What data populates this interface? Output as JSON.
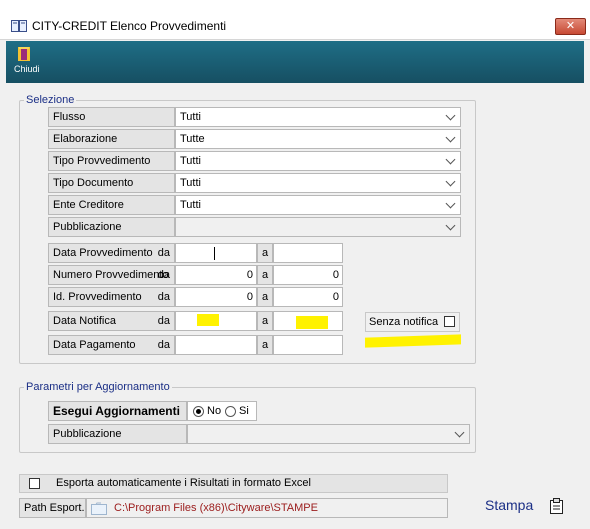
{
  "window": {
    "title": "CITY-CREDIT Elenco Provvedimenti",
    "close_label": "✕"
  },
  "toolbar": {
    "close_label": "Chiudi"
  },
  "selezione": {
    "legend": "Selezione",
    "dropdowns": [
      {
        "label": "Flusso",
        "value": "Tutti"
      },
      {
        "label": "Elaborazione",
        "value": "Tutte"
      },
      {
        "label": "Tipo Provvedimento",
        "value": "Tutti"
      },
      {
        "label": "Tipo Documento",
        "value": "Tutti"
      },
      {
        "label": "Ente Creditore",
        "value": "Tutti"
      },
      {
        "label": "Pubblicazione",
        "value": ""
      }
    ],
    "ranges": [
      {
        "label": "Data Provvedimento",
        "da": "da",
        "from": "",
        "a": "a",
        "to": ""
      },
      {
        "label": "Numero Provvedimento",
        "da": "da",
        "from": "0",
        "a": "a",
        "to": "0"
      },
      {
        "label": "Id. Provvedimento",
        "da": "da",
        "from": "0",
        "a": "a",
        "to": "0"
      },
      {
        "label": "Data Notifica",
        "da": "da",
        "from": "",
        "a": "a",
        "to": ""
      },
      {
        "label": "Data Pagamento",
        "da": "da",
        "from": "",
        "a": "a",
        "to": ""
      }
    ],
    "senza_notifica_label": "Senza notifica",
    "senza_notifica_checked": false
  },
  "parametri": {
    "legend": "Parametri per Aggiornamento",
    "esegui_label": "Esegui Aggiornamenti",
    "radio_no": "No",
    "radio_si": "Si",
    "selected": "No",
    "pubblicazione_label": "Pubblicazione",
    "pubblicazione_value": ""
  },
  "esporta": {
    "checkbox_label": "Esporta automaticamente i Risultati in formato Excel",
    "checked": false,
    "path_label": "Path Esport.",
    "path_value": "C:\\Program Files (x86)\\Cityware\\STAMPE"
  },
  "stampa_label": "Stampa",
  "colors": {
    "toolbar": "#1a5e75",
    "legend": "#1b2f86",
    "highlight": "#fff200",
    "path_text": "#9b1c1c"
  }
}
